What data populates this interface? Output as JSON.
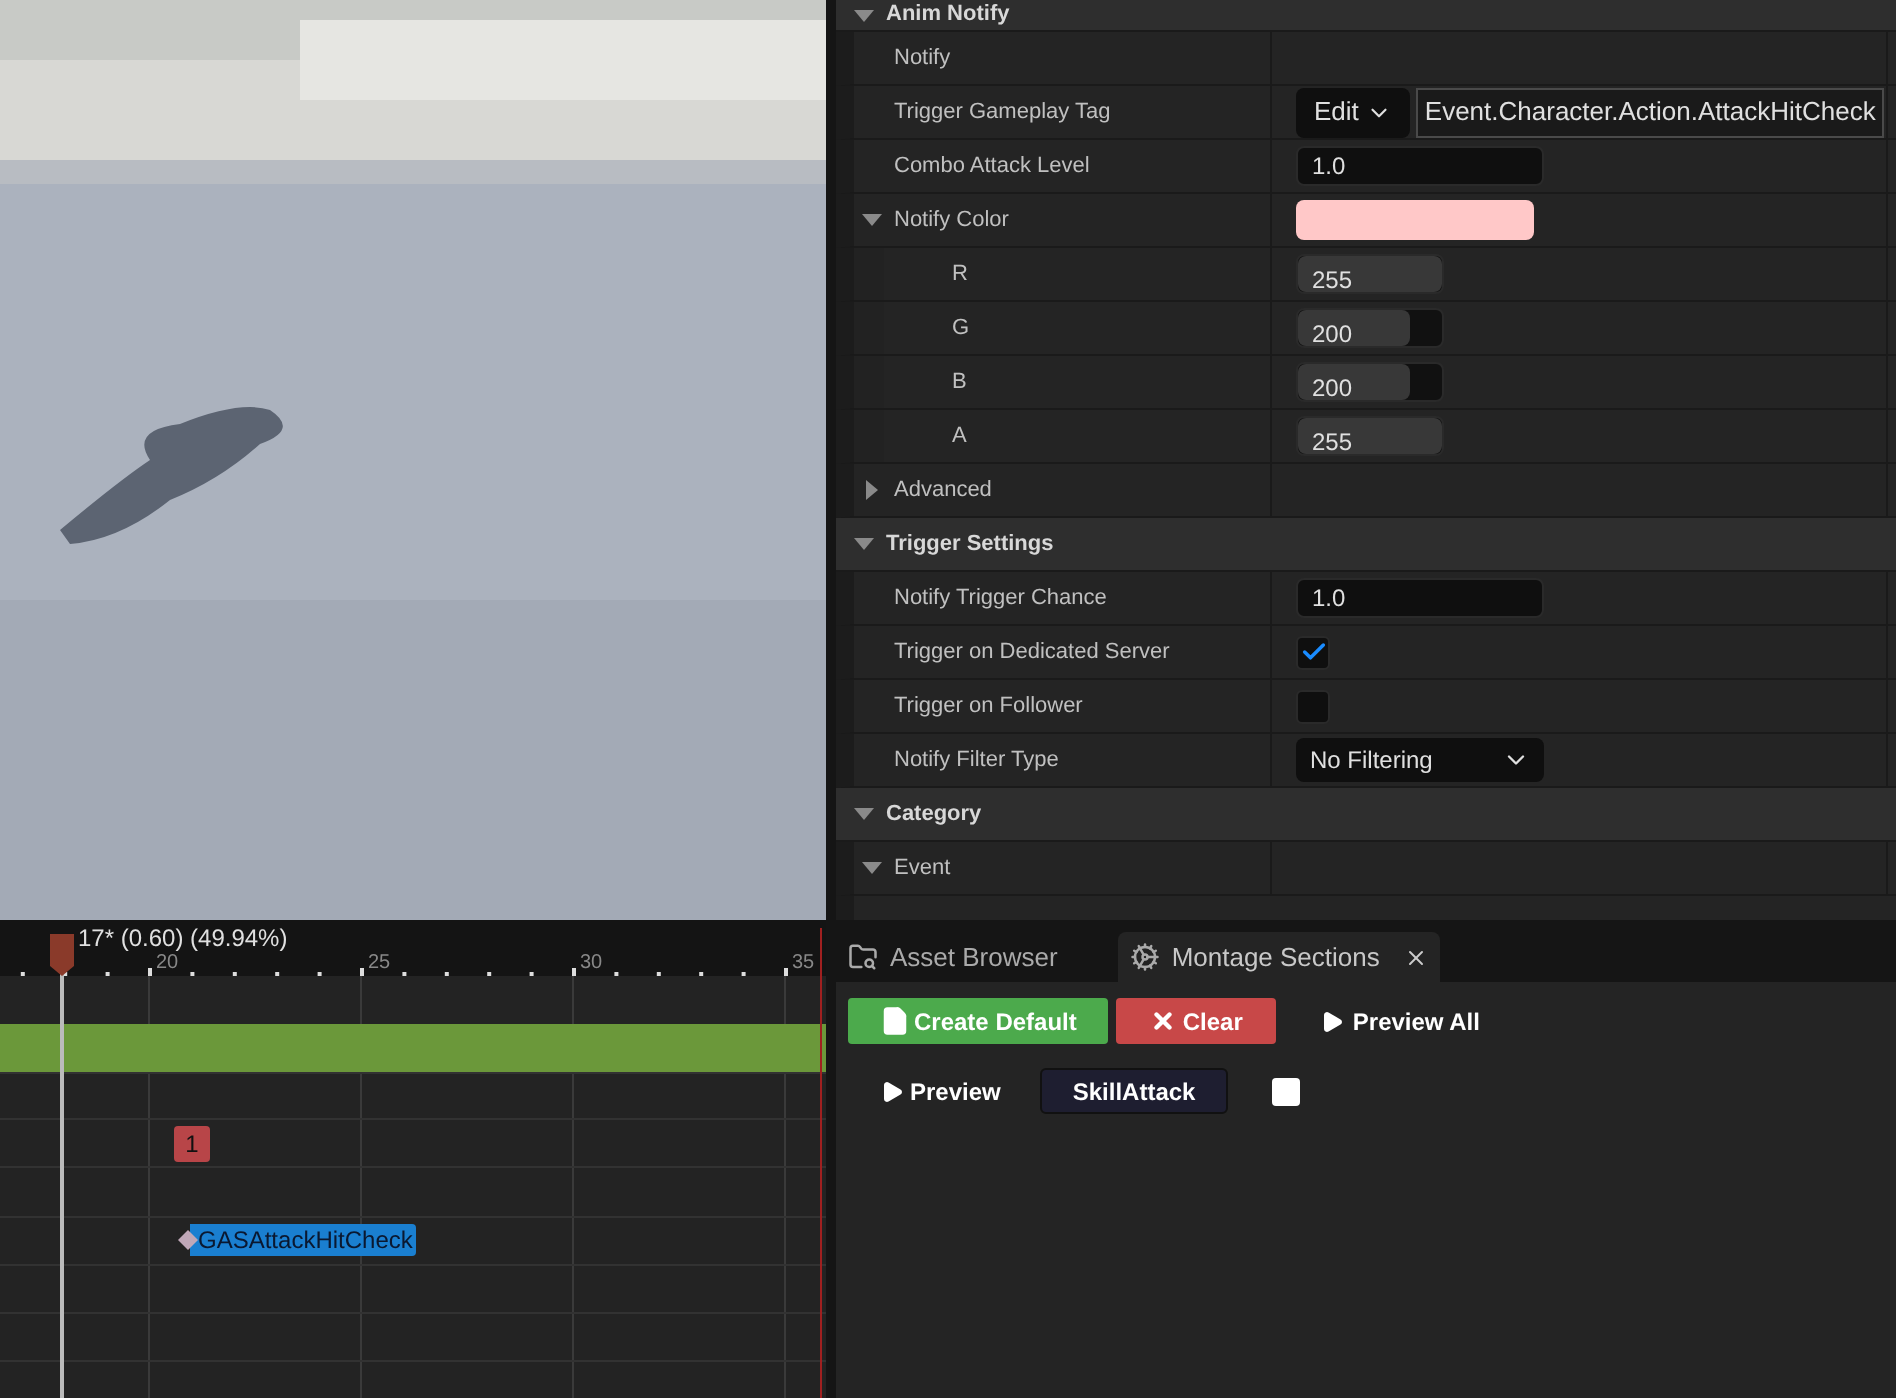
{
  "details": {
    "sections": [
      {
        "label": "Anim Notify",
        "expanded": true,
        "rows": [
          {
            "kind": "text",
            "label": "Notify"
          },
          {
            "kind": "tag",
            "label": "Trigger Gameplay Tag",
            "edit_label": "Edit",
            "value": "Event.Character.Action.AttackHitCheck"
          },
          {
            "kind": "number",
            "label": "Combo Attack Level",
            "value": "1.0"
          },
          {
            "kind": "color",
            "label": "Notify Color",
            "expanded": true,
            "color": "#ffc8c8",
            "children": [
              {
                "kind": "channel",
                "label": "R",
                "value": "255",
                "level": 1
              },
              {
                "kind": "channel",
                "label": "G",
                "value": "200",
                "level": 0.78
              },
              {
                "kind": "channel",
                "label": "B",
                "value": "200",
                "level": 0.78
              },
              {
                "kind": "channel",
                "label": "A",
                "value": "255",
                "level": 1
              }
            ]
          },
          {
            "kind": "group",
            "label": "Advanced",
            "expanded": false
          }
        ]
      },
      {
        "label": "Trigger Settings",
        "expanded": true,
        "rows": [
          {
            "kind": "number",
            "label": "Notify Trigger Chance",
            "value": "1.0"
          },
          {
            "kind": "checkbox",
            "label": "Trigger on Dedicated Server",
            "checked": true
          },
          {
            "kind": "checkbox",
            "label": "Trigger on Follower",
            "checked": false
          },
          {
            "kind": "dropdown",
            "label": "Notify Filter Type",
            "value": "No Filtering"
          }
        ]
      },
      {
        "label": "Category",
        "expanded": true,
        "rows": [
          {
            "kind": "group",
            "label": "Event",
            "expanded": true
          }
        ]
      }
    ]
  },
  "timeline": {
    "playhead_label": "17* (0.60) (49.94%)",
    "ticks": [
      "20",
      "25",
      "30",
      "35"
    ],
    "section_badge": "1",
    "notify": "GASAttackHitCheck"
  },
  "tabs": [
    {
      "label": "Asset Browser",
      "selected": false,
      "closable": false
    },
    {
      "label": "Montage Sections",
      "selected": true,
      "closable": true
    }
  ],
  "sections_panel": {
    "create_default": "Create Default",
    "clear": "Clear",
    "preview_all": "Preview All",
    "preview": "Preview",
    "section_name": "SkillAttack",
    "section_checked": false
  }
}
